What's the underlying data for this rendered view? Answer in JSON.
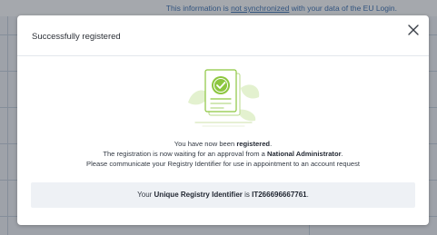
{
  "background": {
    "note_prefix": "This information is ",
    "note_link": "not synchronized",
    "note_suffix": " with your data of the EU Login."
  },
  "modal": {
    "title": "Successfully registered",
    "close_icon": "close-icon",
    "illustration_icon": "document-check-icon",
    "message": {
      "line1_prefix": "You have now been ",
      "line1_bold": "registered",
      "line1_suffix": ".",
      "line2_prefix": "The registration is now waiting for an approval from a ",
      "line2_bold": "National Administrator",
      "line2_suffix": ".",
      "line3": "Please communicate your Registry Identifier for use in appointment to an account request"
    },
    "identifier": {
      "prefix": "Your ",
      "label_bold": "Unique Registry Identifier",
      "middle": " is ",
      "value": "IT266696667761",
      "suffix": "."
    }
  },
  "colors": {
    "accent_green": "#8cc63f",
    "light_green": "#e3f1cf"
  }
}
